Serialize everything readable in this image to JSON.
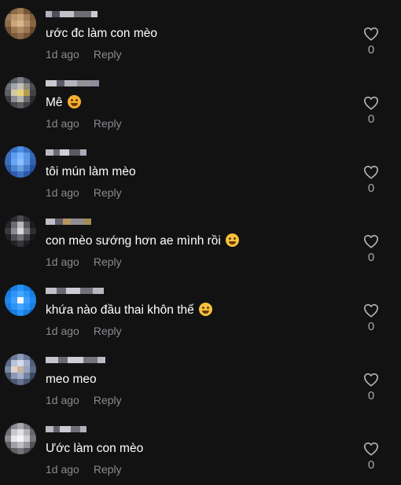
{
  "comments": [
    {
      "text": "ước đc làm con mèo",
      "emoji": "",
      "time": "1d ago",
      "reply_label": "Reply",
      "likes": "0",
      "avatar_colors": [
        "#6b4a2e",
        "#8a6a48",
        "#a07a52",
        "#7a5736",
        "#5b3e25",
        "#9a7a5a",
        "#b8956a",
        "#c9a47a",
        "#a67f58",
        "#7d5c3c",
        "#8e6b47",
        "#c8a67e",
        "#d7b68c",
        "#b5906a",
        "#876645",
        "#6f5034",
        "#9b7752",
        "#b08b63",
        "#9a7550",
        "#6a4a30",
        "#5d412a",
        "#7c5b3c",
        "#8d6a48",
        "#735437",
        "#523822"
      ],
      "username_colors": [
        "#c6c2ce",
        "#7c7490",
        "#d8d4dc",
        "#b0aab8",
        "#e2dee6"
      ]
    },
    {
      "text": "Mê",
      "emoji": "smiling-face-with-hearts",
      "time": "1d ago",
      "reply_label": "Reply",
      "likes": "0",
      "avatar_colors": [
        "#3a3e44",
        "#5a6068",
        "#7c8088",
        "#53575e",
        "#2c2f33",
        "#6b6f74",
        "#a5a8ad",
        "#c4c0b5",
        "#8e8a80",
        "#4a4d52",
        "#5e6064",
        "#d3c9a4",
        "#e8d27a",
        "#b59c52",
        "#404246",
        "#3a3c40",
        "#8d8f93",
        "#b6b3a8",
        "#6a6c70",
        "#2a2c30",
        "#2b2d30",
        "#47494d",
        "#5a5c60",
        "#3c3e42",
        "#222326"
      ],
      "username_colors": [
        "#e0dee6",
        "#8c88a0",
        "#c8c4d0",
        "#e8e6ec",
        "#9c98ac"
      ]
    },
    {
      "text": "tôi mún làm mèo",
      "emoji": "",
      "time": "1d ago",
      "reply_label": "Reply",
      "likes": "0",
      "avatar_colors": [
        "#2f5fa8",
        "#3a74c8",
        "#4c8ee0",
        "#3b74c4",
        "#2a56a0",
        "#3b6fc0",
        "#5a9cf0",
        "#7ab4ff",
        "#5c96e6",
        "#3568b8",
        "#3a6cb8",
        "#6aa6f4",
        "#8cc0ff",
        "#5e98e4",
        "#3260ac",
        "#2c5aa0",
        "#4a84d2",
        "#6a9ee4",
        "#4678c6",
        "#2850a0",
        "#1f3f80",
        "#2e5cae",
        "#3d70c0",
        "#2c58a6",
        "#1c3a7a"
      ],
      "username_colors": [
        "#d0ccd8",
        "#a8a2b6",
        "#e6e2ea",
        "#8e88a0",
        "#c0bbca"
      ]
    },
    {
      "text": "con mèo sướng hơn ae mình rồi",
      "emoji": "grinning-face-with-sweat",
      "time": "1d ago",
      "reply_label": "Reply",
      "likes": "0",
      "avatar_colors": [
        "#1a1a1c",
        "#2c2c30",
        "#4a4a50",
        "#2a2a2e",
        "#141416",
        "#26262a",
        "#6c6c72",
        "#b8b8bc",
        "#56565c",
        "#1c1c20",
        "#3a3a3e",
        "#8a8a90",
        "#d8d8dc",
        "#7a7a80",
        "#2e2e32",
        "#202024",
        "#4c4c52",
        "#6e6e74",
        "#3e3e44",
        "#18181a",
        "#121214",
        "#242428",
        "#36363a",
        "#1e1e22",
        "#0e0e10"
      ],
      "username_colors": [
        "#d4d0da",
        "#9a94aa",
        "#c8a46a",
        "#e4e0e8",
        "#b49a5c"
      ]
    },
    {
      "text": "khứa nào đầu thai khôn thế",
      "emoji": "face-with-tears-of-joy",
      "time": "1d ago",
      "reply_label": "Reply",
      "likes": "0",
      "avatar_colors": [
        "#0f68c8",
        "#1a7ee0",
        "#2890f4",
        "#1a7ee0",
        "#0f68c8",
        "#1a7ee0",
        "#2a94fa",
        "#44a6ff",
        "#2a94fa",
        "#1a7ee0",
        "#1f86ea",
        "#3ca0ff",
        "#f2f7ff",
        "#3ca0ff",
        "#1f86ea",
        "#1a7ee0",
        "#2a94fa",
        "#44a6ff",
        "#2a94fa",
        "#1a7ee0",
        "#0f68c8",
        "#1a7ee0",
        "#2890f4",
        "#1a7ee0",
        "#0f68c8"
      ],
      "username_colors": [
        "#d8d4de",
        "#a8a2b8",
        "#e4e0e8",
        "#b6b0c2",
        "#ccc8d4"
      ]
    },
    {
      "text": "meo meo",
      "emoji": "",
      "time": "1d ago",
      "reply_label": "Reply",
      "likes": "0",
      "avatar_colors": [
        "#4a5670",
        "#6c7a98",
        "#8e9cba",
        "#6a7896",
        "#3e4a64",
        "#5c6a88",
        "#b8c4dc",
        "#d6dcec",
        "#a4b0ca",
        "#505e7c",
        "#7a88a6",
        "#e0d4c8",
        "#c8b4a2",
        "#9aa6c0",
        "#5e6c8a",
        "#48566e",
        "#8c98b4",
        "#a6b2cc",
        "#7482a0",
        "#3c4862",
        "#363e52",
        "#4e5a74",
        "#66728e",
        "#4a566e",
        "#2c3446"
      ],
      "username_colors": [
        "#dcd8e2",
        "#aaa4b8",
        "#e6e2ea",
        "#bcb6c8",
        "#d0ccd8"
      ]
    },
    {
      "text": "Ước làm con mèo",
      "emoji": "",
      "time": "1d ago",
      "reply_label": "Reply",
      "likes": "0",
      "avatar_colors": [
        "#5a5a5e",
        "#8a8a90",
        "#a8a8ae",
        "#7c7c82",
        "#4c4c50",
        "#6e6e74",
        "#c8c8cc",
        "#e0e0e4",
        "#b4b4ba",
        "#66666c",
        "#8c8c92",
        "#e8e8ec",
        "#f4f4f6",
        "#d0d0d4",
        "#76767c",
        "#5c5c62",
        "#a0a0a6",
        "#bcbcc2",
        "#96969c",
        "#505056",
        "#3c3c40",
        "#5e5e64",
        "#74747a",
        "#56565c",
        "#323236"
      ],
      "username_colors": [
        "#cfcbd6",
        "#9e98ae",
        "#e2dee8",
        "#b2acc0",
        "#c6c2ce"
      ]
    }
  ]
}
